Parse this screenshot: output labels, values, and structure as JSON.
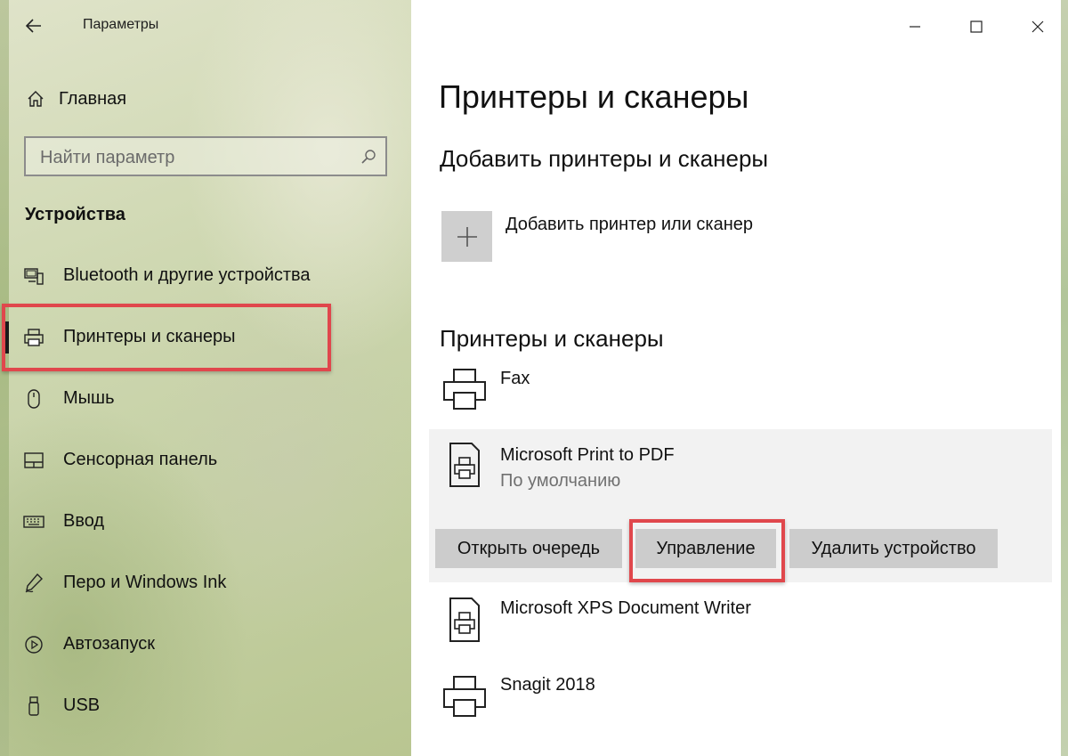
{
  "window": {
    "app_title": "Параметры",
    "controls": [
      "minimize",
      "maximize",
      "close"
    ]
  },
  "sidebar": {
    "home_label": "Главная",
    "search_placeholder": "Найти параметр",
    "section_title": "Устройства",
    "items": [
      {
        "label": "Bluetooth и другие устройства",
        "icon": "bluetooth-devices-icon"
      },
      {
        "label": "Принтеры и сканеры",
        "icon": "printer-icon",
        "active": true
      },
      {
        "label": "Мышь",
        "icon": "mouse-icon"
      },
      {
        "label": "Сенсорная панель",
        "icon": "touchpad-icon"
      },
      {
        "label": "Ввод",
        "icon": "keyboard-icon"
      },
      {
        "label": "Перо и Windows Ink",
        "icon": "pen-icon"
      },
      {
        "label": "Автозапуск",
        "icon": "autoplay-icon"
      },
      {
        "label": "USB",
        "icon": "usb-icon"
      }
    ]
  },
  "main": {
    "page_title": "Принтеры и сканеры",
    "add_section_title": "Добавить принтеры и сканеры",
    "add_label": "Добавить принтер или сканер",
    "list_section_title": "Принтеры и сканеры",
    "printers": [
      {
        "name": "Fax",
        "status": "",
        "icon": "printer-icon"
      },
      {
        "name": "Microsoft Print to PDF",
        "status": "По умолчанию",
        "icon": "printer-document-icon",
        "selected": true
      },
      {
        "name": "Microsoft XPS Document Writer",
        "status": "",
        "icon": "printer-document-icon"
      },
      {
        "name": "Snagit 2018",
        "status": "",
        "icon": "printer-icon"
      }
    ],
    "actions": {
      "open_queue": "Открыть очередь",
      "manage": "Управление",
      "remove": "Удалить устройство"
    }
  },
  "colors": {
    "highlight": "#e0474c",
    "button_bg": "#cccccc",
    "selected_bg": "#f2f2f2"
  }
}
